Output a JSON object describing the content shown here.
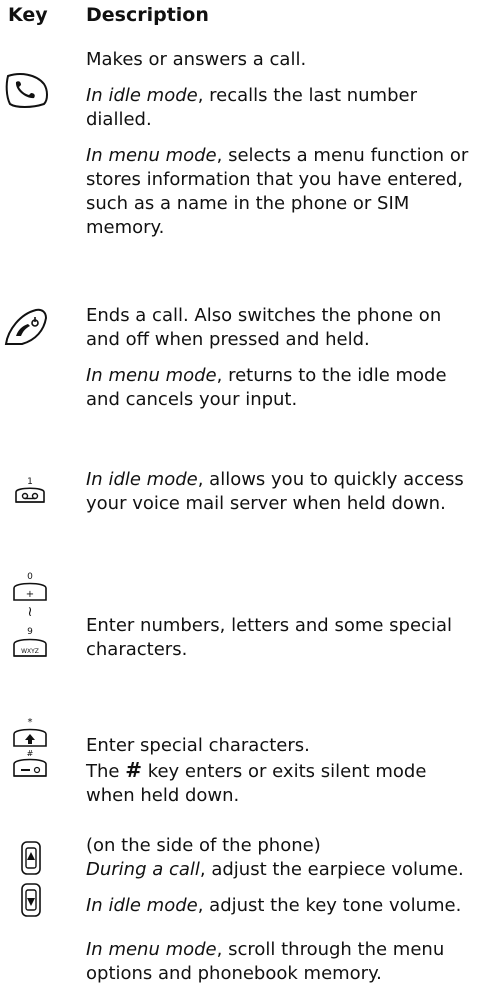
{
  "header": {
    "key": "Key",
    "description": "Description"
  },
  "rows": [
    {
      "icon": "send-key-icon",
      "paragraphs": [
        {
          "plain": "Makes or answers a call."
        },
        {
          "italic": "In idle mode",
          "rest": ", recalls the last number dialled."
        },
        {
          "italic": "In menu mode",
          "rest": ", selects a menu function or stores information that you have entered, such as a name in the phone or SIM memory."
        }
      ]
    },
    {
      "icon": "end-key-icon",
      "paragraphs": [
        {
          "plain": "Ends a call. Also switches the phone on and off when pressed and held."
        },
        {
          "italic": "In menu mode",
          "rest": ", returns to the idle mode and cancels your input."
        }
      ]
    },
    {
      "icon": "voicemail-1-key-icon",
      "paragraphs": [
        {
          "italic": "In idle mode",
          "rest": ", allows you to quickly access your voice mail server when held down."
        }
      ]
    },
    {
      "icon": "number-keys-0-9-icon",
      "key_labels": {
        "top": "0",
        "top_symbol": "+",
        "range": "~",
        "bottom": "9",
        "bottom_symbol": "WXYZ"
      },
      "paragraphs": [
        {
          "plain": "Enter numbers, letters and some special characters."
        }
      ]
    },
    {
      "icon": "star-hash-keys-icon",
      "key_labels": {
        "top": "*",
        "bottom": "#"
      },
      "paragraphs": [
        {
          "plain": "Enter special characters."
        },
        {
          "before": "The ",
          "symbol": "#",
          "after": " key enters or exits silent mode when held down."
        }
      ]
    },
    {
      "icon": "volume-keys-icon",
      "paragraphs": [
        {
          "plain": "(on the side of the phone)"
        },
        {
          "italic": "During a call",
          "rest": ", adjust the earpiece volume."
        },
        {
          "italic": "In idle mode",
          "rest": ", adjust the key tone volume."
        },
        {
          "italic": "In menu mode",
          "rest": ", scroll through the menu options and phonebook memory."
        }
      ]
    }
  ]
}
